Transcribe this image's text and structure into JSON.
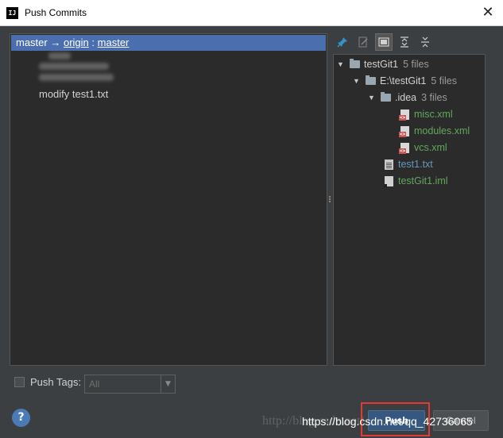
{
  "window": {
    "app_icon_text": "IJ",
    "title": "Push Commits",
    "close_glyph": "✕"
  },
  "branch": {
    "local": "master",
    "arrow": "→",
    "remote": "origin",
    "separator": ":",
    "remote_branch": "master"
  },
  "commits": [
    {
      "message": "modify test1.txt"
    }
  ],
  "toolbar": {
    "icons": [
      "pin-icon",
      "edit-source-icon",
      "group-by-directory-icon",
      "expand-all-icon",
      "collapse-all-icon"
    ]
  },
  "tree": [
    {
      "label": "testGit1",
      "count": "5 files",
      "kind": "root"
    },
    {
      "label": "E:\\testGit1",
      "count": "5 files",
      "kind": "folder"
    },
    {
      "label": ".idea",
      "count": "3 files",
      "kind": "folder"
    },
    {
      "label": "misc.xml",
      "kind": "xml"
    },
    {
      "label": "modules.xml",
      "kind": "xml"
    },
    {
      "label": "vcs.xml",
      "kind": "xml"
    },
    {
      "label": "test1.txt",
      "kind": "txt"
    },
    {
      "label": "testGit1.iml",
      "kind": "iml"
    }
  ],
  "push_tags": {
    "label": "Push Tags:",
    "value": "All"
  },
  "buttons": {
    "help": "?",
    "push": "Push",
    "cancel": "Cancel"
  },
  "watermark": {
    "text1": "http://blog.csdn.net/",
    "text2": "https://blog.csdn.net/qq_42736065"
  },
  "colors": {
    "selection": "#4b6eaf",
    "modified_file": "#6897bb",
    "added_file": "#62a85c",
    "highlight": "#e53935"
  }
}
